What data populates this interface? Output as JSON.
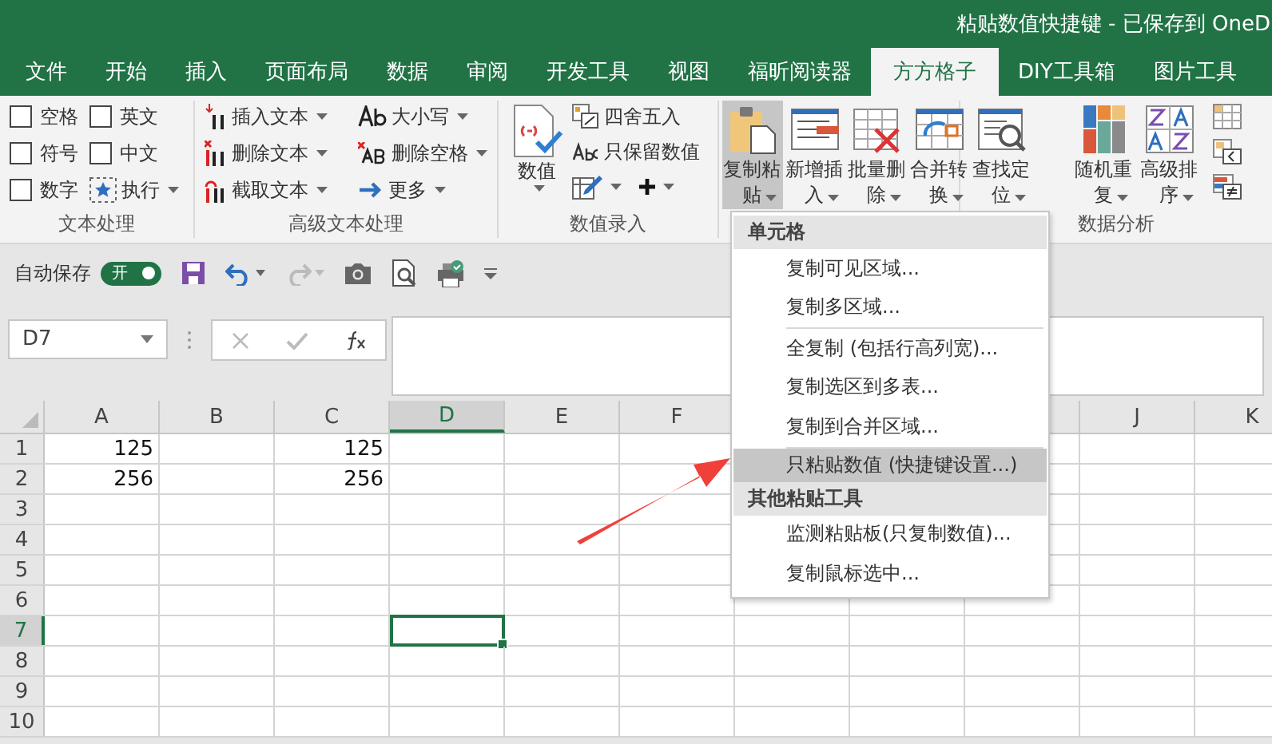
{
  "window": {
    "title": "粘贴数值快捷键 - 已保存到 OneD"
  },
  "tabs": [
    {
      "label": "文件",
      "selected": false
    },
    {
      "label": "开始",
      "selected": false
    },
    {
      "label": "插入",
      "selected": false
    },
    {
      "label": "页面布局",
      "selected": false
    },
    {
      "label": "数据",
      "selected": false
    },
    {
      "label": "审阅",
      "selected": false
    },
    {
      "label": "开发工具",
      "selected": false
    },
    {
      "label": "视图",
      "selected": false
    },
    {
      "label": "福昕阅读器",
      "selected": false
    },
    {
      "label": "方方格子",
      "selected": true
    },
    {
      "label": "DIY工具箱",
      "selected": false
    },
    {
      "label": "图片工具",
      "selected": false
    }
  ],
  "ribbon": {
    "text_group": {
      "label": "文本处理",
      "checkboxes": [
        {
          "label": "空格",
          "checked": false
        },
        {
          "label": "英文",
          "checked": false
        },
        {
          "label": "符号",
          "checked": false
        },
        {
          "label": "中文",
          "checked": false
        },
        {
          "label": "数字",
          "checked": false
        }
      ],
      "run_button": "执行"
    },
    "advanced_text_group": {
      "label": "高级文本处理",
      "commands": [
        {
          "label": "插入文本",
          "kind": "insert"
        },
        {
          "label": "大小写",
          "kind": "case"
        },
        {
          "label": "删除文本",
          "kind": "delete"
        },
        {
          "label": "删除空格",
          "kind": "trim"
        },
        {
          "label": "截取文本",
          "kind": "extract"
        },
        {
          "label": "更多",
          "kind": "more"
        }
      ]
    },
    "number_group": {
      "label": "数值录入",
      "big_button": "数值",
      "commands": [
        {
          "label": "四舍五入",
          "kind": "round"
        },
        {
          "label": "只保留数值",
          "kind": "keep"
        }
      ]
    },
    "tools_group": {
      "buttons": [
        {
          "label": "复制粘贴",
          "kind": "paste",
          "selected": true
        },
        {
          "label": "新增插入",
          "kind": "insert",
          "selected": false
        },
        {
          "label": "批量删除",
          "kind": "delete",
          "selected": false
        },
        {
          "label": "合并转换",
          "kind": "merge",
          "selected": false
        },
        {
          "label": "查找定位",
          "kind": "find",
          "selected": false
        }
      ]
    },
    "analysis_group": {
      "label": "数据分析",
      "buttons": [
        {
          "label": "随机重复",
          "kind": "random"
        },
        {
          "label": "高级排序",
          "kind": "sort"
        }
      ]
    }
  },
  "quick_access": {
    "autosave_label": "自动保存",
    "autosave": {
      "on": true,
      "label": "开"
    }
  },
  "formula_bar": {
    "name_box": "D7"
  },
  "sheet": {
    "columns": [
      {
        "label": "A"
      },
      {
        "label": "B"
      },
      {
        "label": "C"
      },
      {
        "label": "D"
      },
      {
        "label": "E"
      },
      {
        "label": "F"
      },
      {},
      {},
      {},
      {
        "label": "J"
      },
      {
        "label": "K"
      }
    ],
    "rows": [
      {
        "label": "1",
        "cells": [
          {
            "value": "125",
            "selected": false
          },
          {
            "selected": false
          },
          {
            "value": "125",
            "selected": false
          },
          {
            "selected": false
          }
        ]
      },
      {
        "label": "2",
        "cells": [
          {
            "value": "256",
            "selected": false
          },
          {
            "selected": false
          },
          {
            "value": "256",
            "selected": false
          },
          {
            "selected": false
          }
        ]
      },
      {
        "label": "3",
        "cells": [
          {
            "selected": false
          },
          {
            "selected": false
          },
          {
            "selected": false
          },
          {
            "selected": false
          }
        ]
      },
      {
        "label": "4",
        "cells": [
          {
            "selected": false
          },
          {
            "selected": false
          },
          {
            "selected": false
          },
          {
            "selected": false
          }
        ]
      },
      {
        "label": "5",
        "cells": [
          {
            "selected": false
          },
          {
            "selected": false
          },
          {
            "selected": false
          },
          {
            "selected": false
          }
        ]
      },
      {
        "label": "6",
        "cells": [
          {
            "selected": false
          },
          {
            "selected": false
          },
          {
            "selected": false
          },
          {
            "selected": false
          }
        ]
      },
      {
        "label": "7",
        "cells": [
          {
            "selected": false
          },
          {
            "selected": false
          },
          {
            "selected": false
          },
          {
            "selected": true
          }
        ]
      },
      {
        "label": "8",
        "cells": [
          {
            "selected": false
          },
          {
            "selected": false
          },
          {
            "selected": false
          },
          {
            "selected": false
          }
        ]
      },
      {
        "label": "9",
        "cells": [
          {
            "selected": false
          },
          {
            "selected": false
          },
          {
            "selected": false
          },
          {
            "selected": false
          }
        ]
      },
      {
        "label": "10",
        "cells": [
          {
            "selected": false
          },
          {
            "selected": false
          },
          {
            "selected": false
          },
          {
            "selected": false
          }
        ]
      }
    ]
  },
  "paste_menu": {
    "items": [
      {
        "kind": "header",
        "label": "单元格"
      },
      {
        "kind": "item",
        "label": "复制可见区域...",
        "selected": false
      },
      {
        "kind": "item",
        "label": "复制多区域...",
        "selected": false
      },
      {
        "kind": "separator"
      },
      {
        "kind": "item",
        "label": "全复制 (包括行高列宽)...",
        "selected": false
      },
      {
        "kind": "item",
        "label": "复制选区到多表...",
        "selected": false
      },
      {
        "kind": "item",
        "label": "复制到合并区域...",
        "selected": false
      },
      {
        "kind": "separator"
      },
      {
        "kind": "item",
        "label": "只粘贴数值 (快捷键设置...)",
        "selected": true
      },
      {
        "kind": "header",
        "label": "其他粘贴工具"
      },
      {
        "kind": "item",
        "label": "监测粘贴板(只复制数值)...",
        "selected": false
      },
      {
        "kind": "item",
        "label": "复制鼠标选中...",
        "selected": false
      }
    ]
  }
}
